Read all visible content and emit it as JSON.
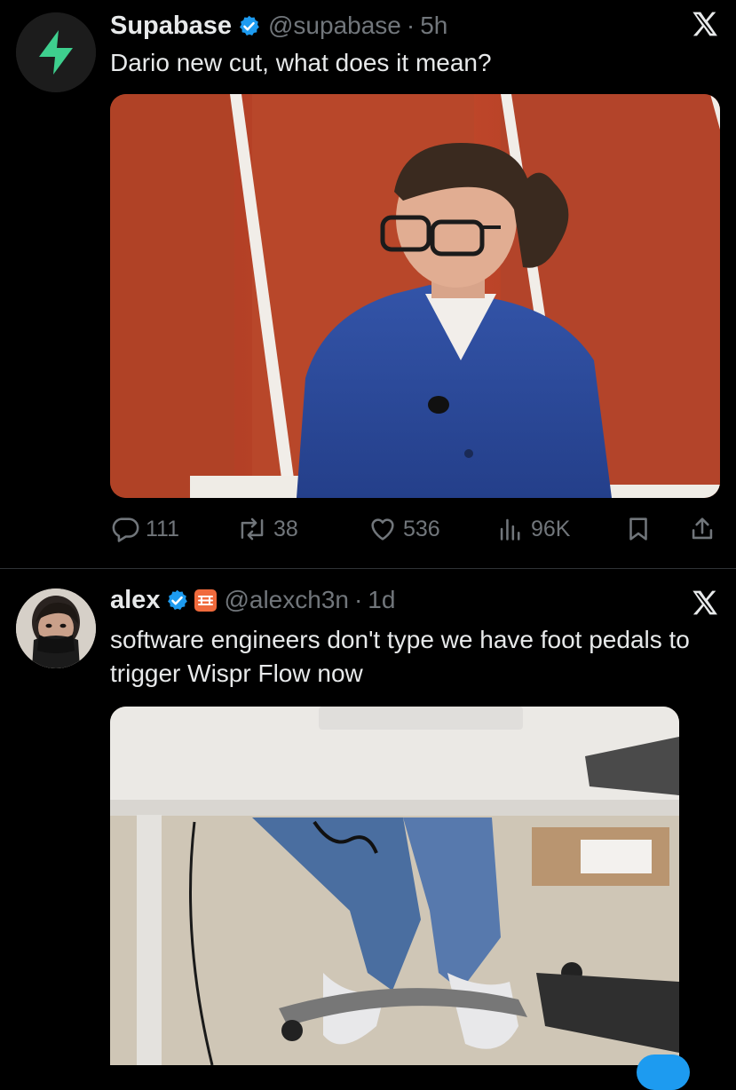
{
  "tweets": [
    {
      "author": "Supabase",
      "handle": "@supabase",
      "separator": "·",
      "time": "5h",
      "text": "Dario new cut, what does it mean?",
      "avatar_icon": "supabase-bolt-logo",
      "verified": true,
      "stats": {
        "replies": "111",
        "reposts": "38",
        "likes": "536",
        "views": "96K"
      }
    },
    {
      "author": "alex",
      "handle": "@alexch3n",
      "separator": "·",
      "time": "1d",
      "text": "software engineers don't type we have foot pedals to trigger Wispr Flow now",
      "verified": true,
      "affiliate_badge": true
    }
  ],
  "colors": {
    "background": "#000000",
    "text_primary": "#e7e9ea",
    "text_secondary": "#71767b",
    "verified_blue": "#1d9bf0",
    "supabase_green": "#3ecf8e"
  }
}
